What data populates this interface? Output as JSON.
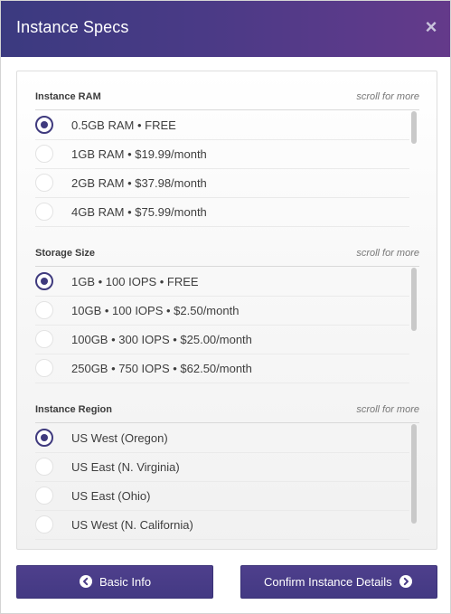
{
  "modal": {
    "title": "Instance Specs",
    "close_glyph": "×"
  },
  "sections": [
    {
      "title": "Instance RAM",
      "hint": "scroll for more",
      "options": [
        {
          "label": "0.5GB RAM • FREE",
          "selected": true
        },
        {
          "label": "1GB RAM • $19.99/month",
          "selected": false
        },
        {
          "label": "2GB RAM • $37.98/month",
          "selected": false
        },
        {
          "label": "4GB RAM • $75.99/month",
          "selected": false
        }
      ]
    },
    {
      "title": "Storage Size",
      "hint": "scroll for more",
      "options": [
        {
          "label": "1GB • 100 IOPS • FREE",
          "selected": true
        },
        {
          "label": "10GB • 100 IOPS • $2.50/month",
          "selected": false
        },
        {
          "label": "100GB • 300 IOPS • $25.00/month",
          "selected": false
        },
        {
          "label": "250GB • 750 IOPS • $62.50/month",
          "selected": false
        }
      ]
    },
    {
      "title": "Instance Region",
      "hint": "scroll for more",
      "options": [
        {
          "label": "US West (Oregon)",
          "selected": true
        },
        {
          "label": "US East (N. Virginia)",
          "selected": false
        },
        {
          "label": "US East (Ohio)",
          "selected": false
        },
        {
          "label": "US West (N. California)",
          "selected": false
        }
      ]
    }
  ],
  "footer": {
    "back_label": "Basic Info",
    "back_icon": "chevron-left-circle-icon",
    "next_label": "Confirm Instance Details",
    "next_icon": "chevron-right-circle-icon"
  },
  "colors": {
    "header_start": "#3b3a80",
    "header_end": "#643a8a",
    "accent": "#3f3a7e",
    "button": "#4a3c88"
  }
}
